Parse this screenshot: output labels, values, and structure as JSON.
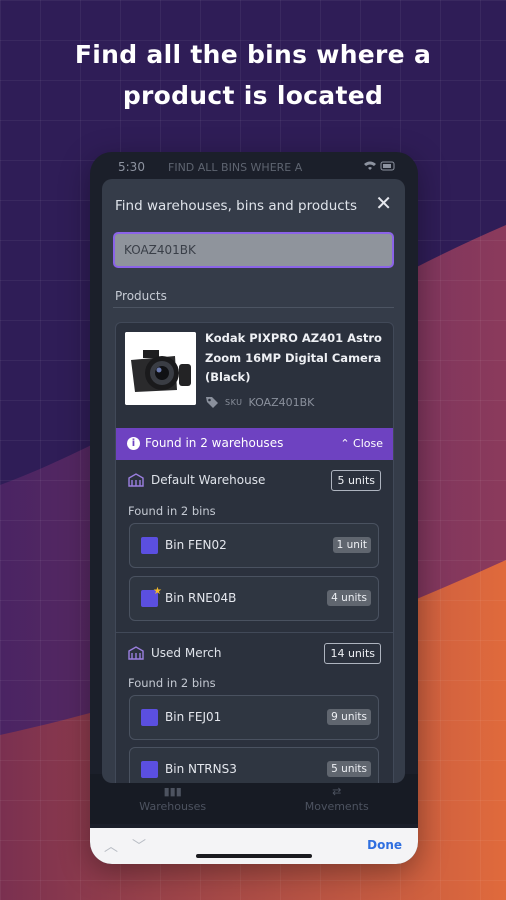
{
  "headline": {
    "line1": "Find all the bins where a",
    "line2": "product is located"
  },
  "status": {
    "time": "5:30",
    "title": "FIND ALL BINS WHERE A"
  },
  "tabbar": {
    "left": "Warehouses",
    "right": "Movements"
  },
  "keyboard_bar": {
    "done": "Done"
  },
  "modal": {
    "title": "Find warehouses, bins and products",
    "search": {
      "value": "KOAZ401BK"
    },
    "section_label": "Products",
    "product": {
      "name": "Kodak PIXPRO AZ401 Astro Zoom 16MP Digital Camera (Black)",
      "sku_label": "SKU",
      "sku": "KOAZ401BK"
    },
    "found_banner": {
      "text": "Found in 2 warehouses",
      "close": "Close"
    },
    "warehouses": [
      {
        "name": "Default Warehouse",
        "units": "5 units",
        "bins_label": "Found in 2 bins",
        "bins": [
          {
            "name": "Bin FEN02",
            "units": "1 unit",
            "starred": false
          },
          {
            "name": "Bin RNE04B",
            "units": "4 units",
            "starred": true
          }
        ]
      },
      {
        "name": "Used Merch",
        "units": "14 units",
        "bins_label": "Found in 2 bins",
        "bins": [
          {
            "name": "Bin FEJ01",
            "units": "9 units",
            "starred": false
          },
          {
            "name": "Bin NTRNS3",
            "units": "5 units",
            "starred": false
          }
        ]
      }
    ]
  },
  "colors": {
    "accent": "#6e42c1",
    "bin": "#5b4fe0",
    "star": "#f2b82b",
    "link": "#2f6fe0"
  },
  "icons": [
    "close-icon",
    "info-icon",
    "chevron-up-icon",
    "warehouse-icon",
    "bin-icon",
    "star-icon",
    "tag-icon",
    "wifi-icon",
    "battery-icon"
  ]
}
